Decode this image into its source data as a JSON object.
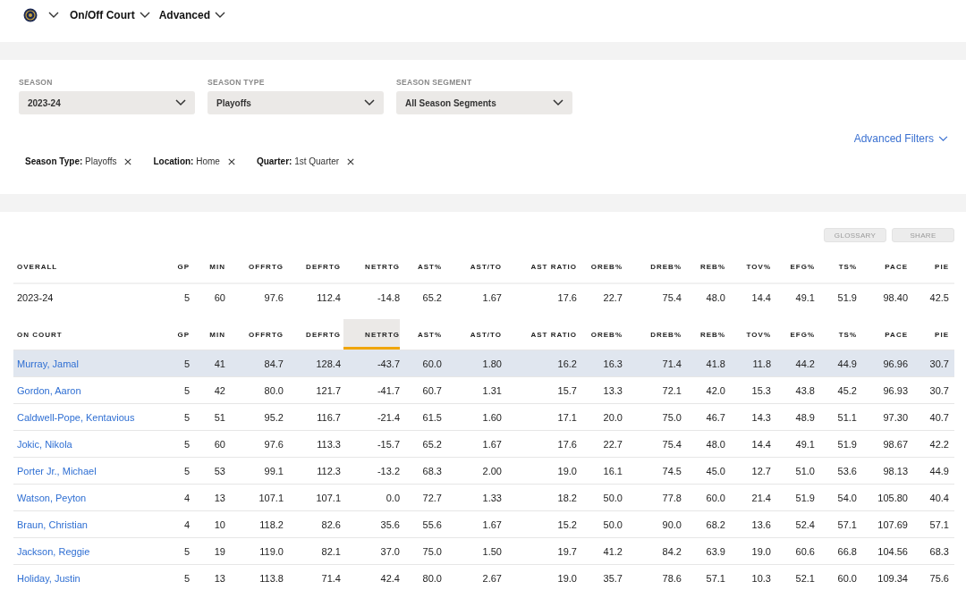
{
  "nav": {
    "menus": [
      {
        "label": "On/Off Court"
      },
      {
        "label": "Advanced"
      }
    ]
  },
  "filters": {
    "dropdowns": [
      {
        "label": "SEASON",
        "value": "2023-24"
      },
      {
        "label": "SEASON TYPE",
        "value": "Playoffs"
      },
      {
        "label": "SEASON SEGMENT",
        "value": "All Season Segments"
      }
    ],
    "advanced_link": "Advanced Filters",
    "chips": [
      {
        "key": "Season Type:",
        "value": "Playoffs"
      },
      {
        "key": "Location:",
        "value": "Home"
      },
      {
        "key": "Quarter:",
        "value": "1st Quarter"
      }
    ]
  },
  "actions": [
    "GLOSSARY",
    "SHARE"
  ],
  "overall": {
    "columns": [
      "OVERALL",
      "GP",
      "MIN",
      "OFFRTG",
      "DEFRTG",
      "NETRTG",
      "AST%",
      "AST/TO",
      "AST RATIO",
      "OREB%",
      "DREB%",
      "REB%",
      "TOV%",
      "EFG%",
      "TS%",
      "PACE",
      "PIE"
    ],
    "row": [
      "2023-24",
      "5",
      "60",
      "97.6",
      "112.4",
      "-14.8",
      "65.2",
      "1.67",
      "17.6",
      "22.7",
      "75.4",
      "48.0",
      "14.4",
      "49.1",
      "51.9",
      "98.40",
      "42.5"
    ]
  },
  "on_court": {
    "columns": [
      {
        "label": "ON COURT",
        "sorted": false
      },
      {
        "label": "GP",
        "sorted": false
      },
      {
        "label": "MIN",
        "sorted": false
      },
      {
        "label": "OFFRTG",
        "sorted": false
      },
      {
        "label": "DEFRTG",
        "sorted": false
      },
      {
        "label": "NETRTG",
        "sorted": true
      },
      {
        "label": "AST%",
        "sorted": false
      },
      {
        "label": "AST/TO",
        "sorted": false
      },
      {
        "label": "AST RATIO",
        "sorted": false
      },
      {
        "label": "OREB%",
        "sorted": false
      },
      {
        "label": "DREB%",
        "sorted": false
      },
      {
        "label": "REB%",
        "sorted": false
      },
      {
        "label": "TOV%",
        "sorted": false
      },
      {
        "label": "EFG%",
        "sorted": false
      },
      {
        "label": "TS%",
        "sorted": false
      },
      {
        "label": "PACE",
        "sorted": false
      },
      {
        "label": "PIE",
        "sorted": false
      }
    ],
    "rows": [
      {
        "selected": true,
        "player": "Murray, Jamal",
        "values": [
          "5",
          "41",
          "84.7",
          "128.4",
          "-43.7",
          "60.0",
          "1.80",
          "16.2",
          "16.3",
          "71.4",
          "41.8",
          "11.8",
          "44.2",
          "44.9",
          "96.96",
          "30.7"
        ]
      },
      {
        "selected": false,
        "player": "Gordon, Aaron",
        "values": [
          "5",
          "42",
          "80.0",
          "121.7",
          "-41.7",
          "60.7",
          "1.31",
          "15.7",
          "13.3",
          "72.1",
          "42.0",
          "15.3",
          "43.8",
          "45.2",
          "96.93",
          "30.7"
        ]
      },
      {
        "selected": false,
        "player": "Caldwell-Pope, Kentavious",
        "values": [
          "5",
          "51",
          "95.2",
          "116.7",
          "-21.4",
          "61.5",
          "1.60",
          "17.1",
          "20.0",
          "75.0",
          "46.7",
          "14.3",
          "48.9",
          "51.1",
          "97.30",
          "40.7"
        ]
      },
      {
        "selected": false,
        "player": "Jokic, Nikola",
        "values": [
          "5",
          "60",
          "97.6",
          "113.3",
          "-15.7",
          "65.2",
          "1.67",
          "17.6",
          "22.7",
          "75.4",
          "48.0",
          "14.4",
          "49.1",
          "51.9",
          "98.67",
          "42.2"
        ]
      },
      {
        "selected": false,
        "player": "Porter Jr., Michael",
        "values": [
          "5",
          "53",
          "99.1",
          "112.3",
          "-13.2",
          "68.3",
          "2.00",
          "19.0",
          "16.1",
          "74.5",
          "45.0",
          "12.7",
          "51.0",
          "53.6",
          "98.13",
          "44.9"
        ]
      },
      {
        "selected": false,
        "player": "Watson, Peyton",
        "values": [
          "4",
          "13",
          "107.1",
          "107.1",
          "0.0",
          "72.7",
          "1.33",
          "18.2",
          "50.0",
          "77.8",
          "60.0",
          "21.4",
          "51.9",
          "54.0",
          "105.80",
          "40.4"
        ]
      },
      {
        "selected": false,
        "player": "Braun, Christian",
        "values": [
          "4",
          "10",
          "118.2",
          "82.6",
          "35.6",
          "55.6",
          "1.67",
          "15.2",
          "50.0",
          "90.0",
          "68.2",
          "13.6",
          "52.4",
          "57.1",
          "107.69",
          "57.1"
        ]
      },
      {
        "selected": false,
        "player": "Jackson, Reggie",
        "values": [
          "5",
          "19",
          "119.0",
          "82.1",
          "37.0",
          "75.0",
          "1.50",
          "19.7",
          "41.2",
          "84.2",
          "63.9",
          "19.0",
          "60.6",
          "66.8",
          "104.56",
          "68.3"
        ]
      },
      {
        "selected": false,
        "player": "Holiday, Justin",
        "values": [
          "5",
          "13",
          "113.8",
          "71.4",
          "42.4",
          "80.0",
          "2.67",
          "19.0",
          "35.7",
          "78.6",
          "57.1",
          "10.3",
          "52.1",
          "60.0",
          "109.34",
          "75.6"
        ]
      }
    ]
  }
}
